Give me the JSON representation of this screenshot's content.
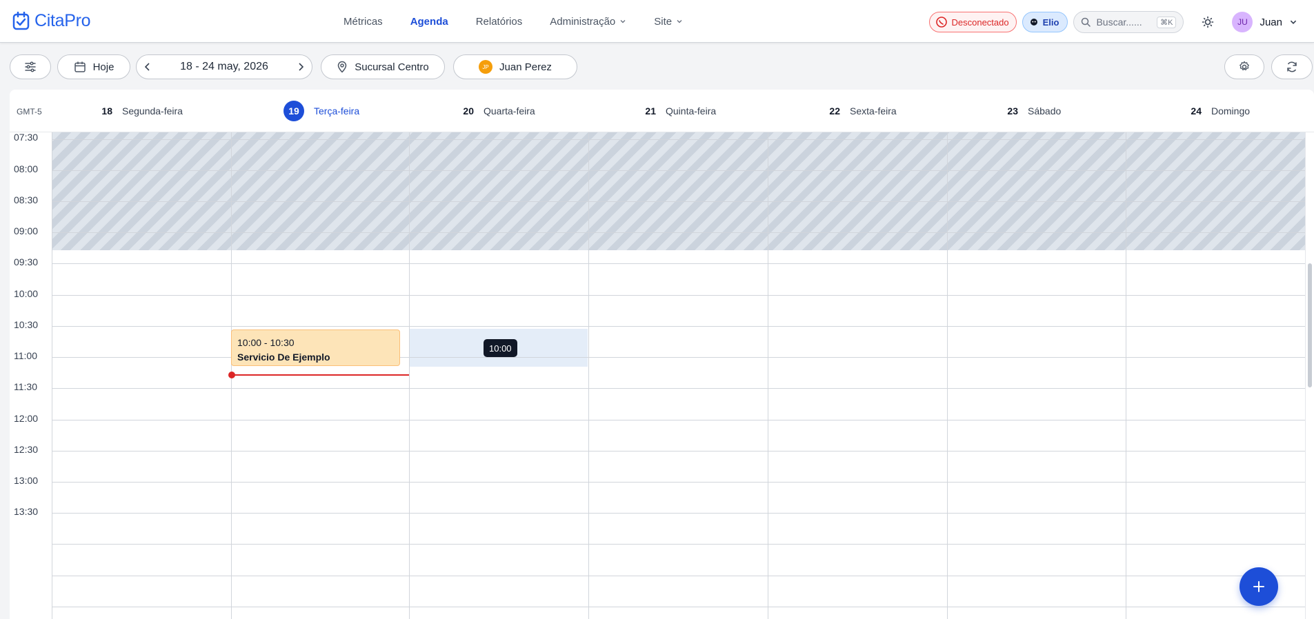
{
  "app": {
    "logo_text": "CitaPro",
    "brand_color": "#2563eb"
  },
  "nav": {
    "items": [
      {
        "label": "Métricas",
        "active": false,
        "dropdown": false
      },
      {
        "label": "Agenda",
        "active": true,
        "dropdown": false
      },
      {
        "label": "Relatórios",
        "active": false,
        "dropdown": false
      },
      {
        "label": "Administração",
        "active": false,
        "dropdown": true
      },
      {
        "label": "Site",
        "active": false,
        "dropdown": true
      }
    ]
  },
  "header": {
    "whatsapp_status": "Desconectado",
    "assistant_label": "Elio",
    "search_placeholder": "Buscar......",
    "search_shortcut": "⌘K",
    "user_initials": "JU",
    "user_name": "Juan"
  },
  "toolbar": {
    "today_label": "Hoje",
    "date_range": "18 - 24 may, 2026",
    "branch_label": "Sucursal Centro",
    "staff_initials": "JP",
    "staff_name": "Juan Perez"
  },
  "calendar": {
    "timezone": "GMT-5",
    "days": [
      {
        "num": "18",
        "name": "Segunda-feira",
        "today": false
      },
      {
        "num": "19",
        "name": "Terça-feira",
        "today": true
      },
      {
        "num": "20",
        "name": "Quarta-feira",
        "today": false
      },
      {
        "num": "21",
        "name": "Quinta-feira",
        "today": false
      },
      {
        "num": "22",
        "name": "Sexta-feira",
        "today": false
      },
      {
        "num": "23",
        "name": "Sábado",
        "today": false
      },
      {
        "num": "24",
        "name": "Domingo",
        "today": false
      }
    ],
    "time_slots": [
      "07:30",
      "08:00",
      "08:30",
      "09:00",
      "09:30",
      "10:00",
      "10:30",
      "11:00",
      "11:30",
      "12:00",
      "12:30",
      "13:00",
      "13:30"
    ],
    "hover_tooltip": "10:00",
    "event": {
      "time": "10:00 - 10:30",
      "service": "Servicio De Ejemplo"
    }
  }
}
